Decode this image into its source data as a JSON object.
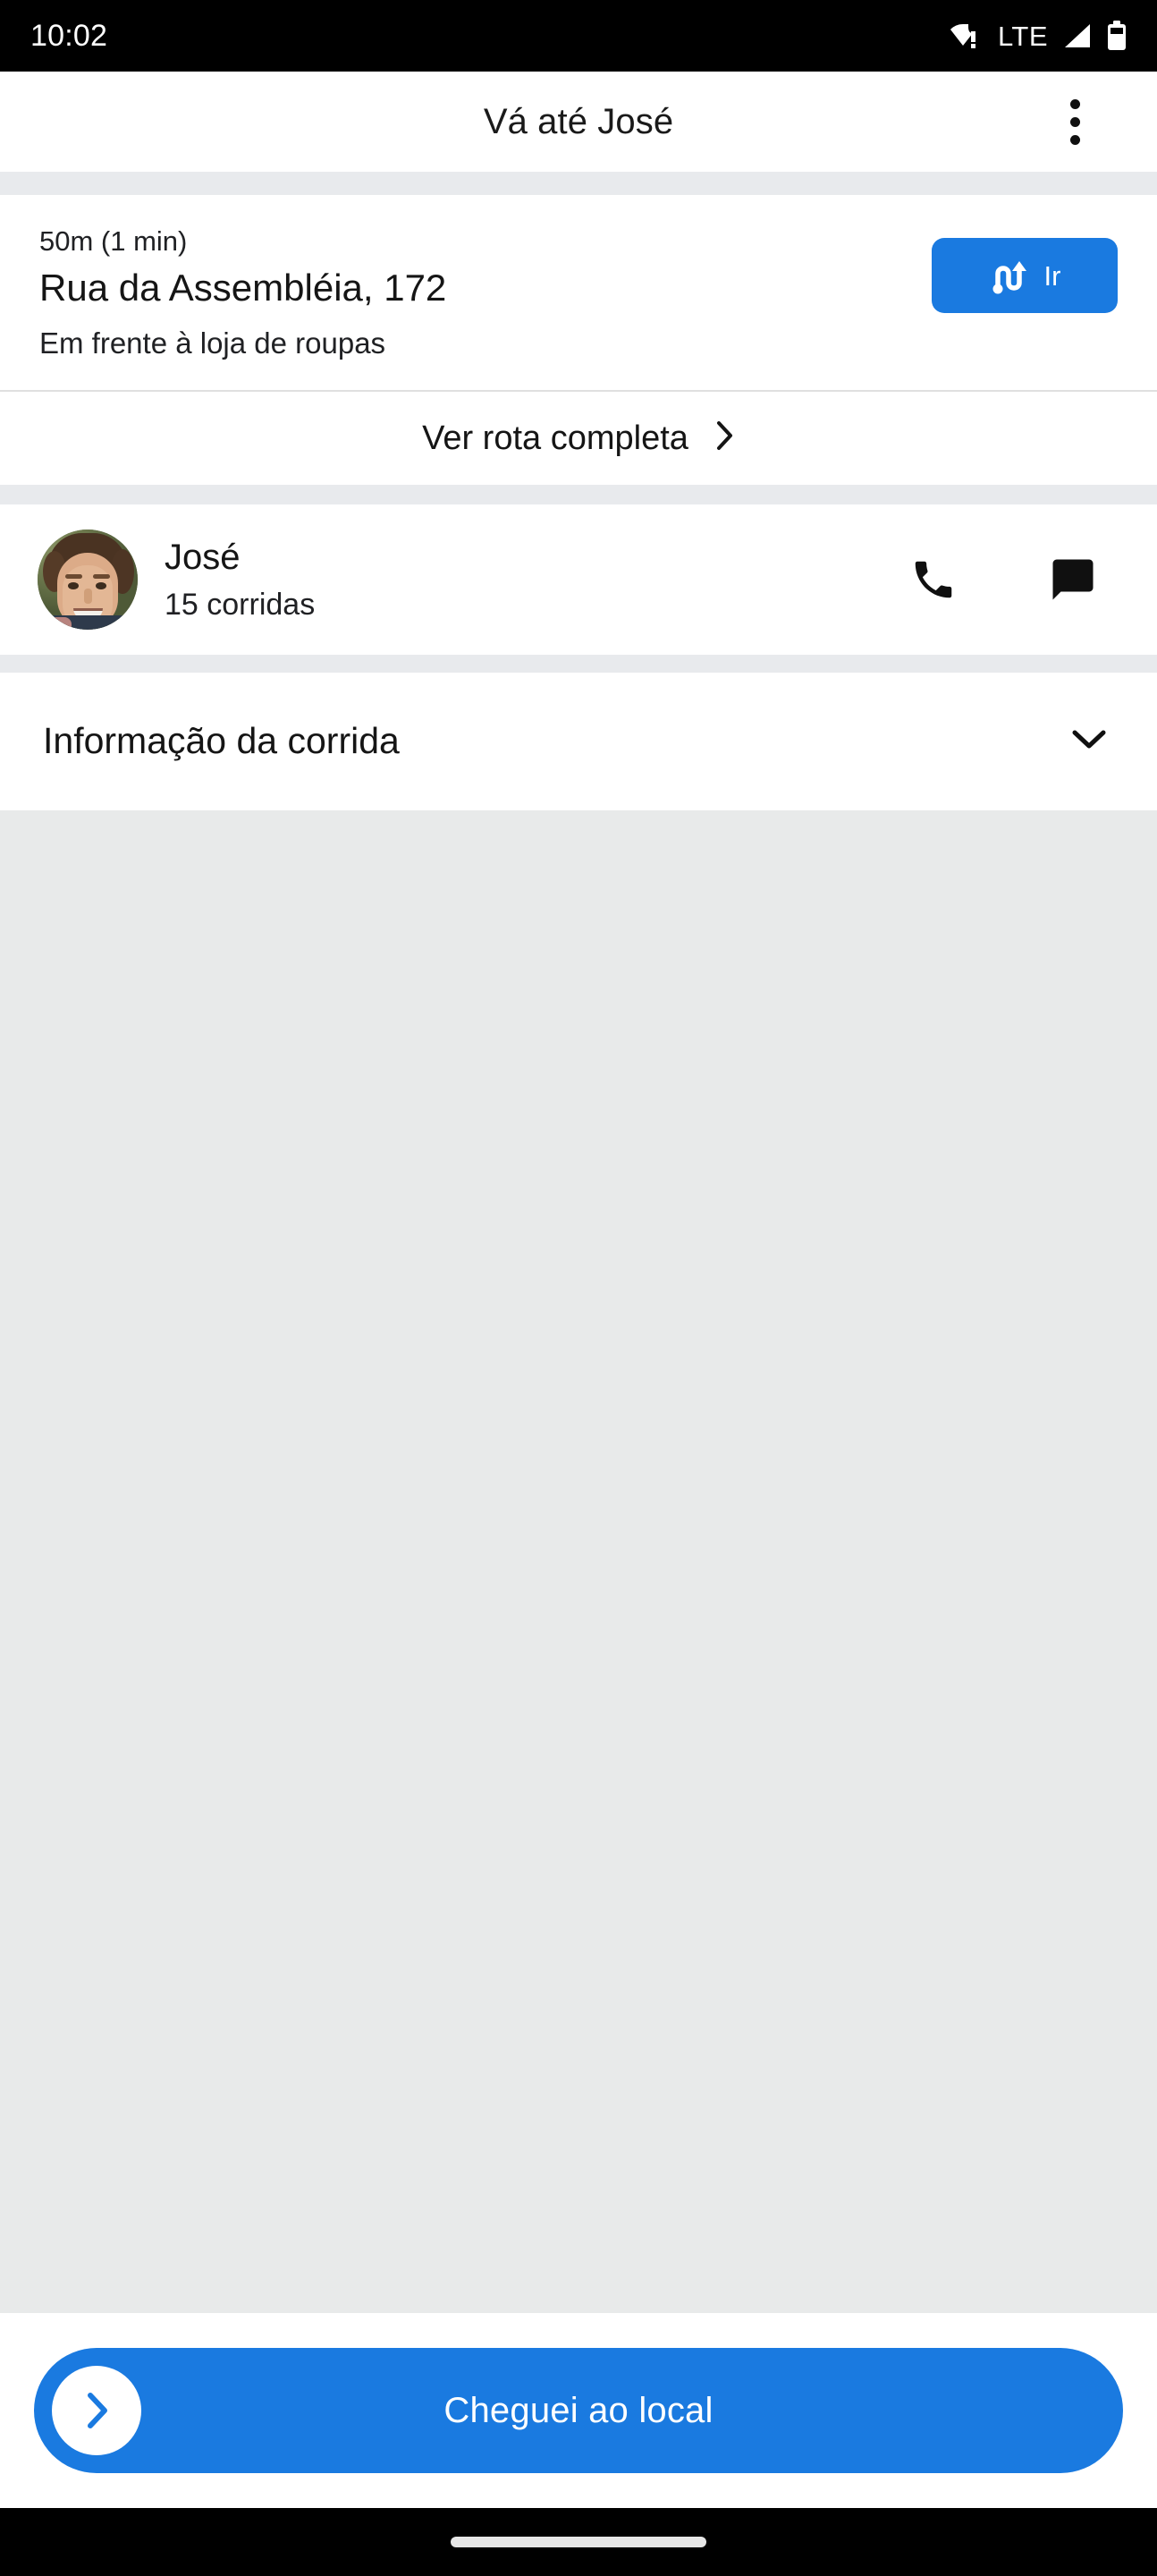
{
  "status_bar": {
    "time": "10:02",
    "network_label": "LTE",
    "wifi_icon": "wifi-warning-icon",
    "signal_icon": "signal-bars-icon",
    "battery_icon": "battery-icon"
  },
  "app_bar": {
    "title": "Vá até José",
    "overflow_icon": "more-vert-icon"
  },
  "destination": {
    "eta": "50m (1 min)",
    "address": "Rua da Assembléia, 172",
    "note": "Em frente à loja de roupas",
    "go_button_label": "Ir",
    "go_button_icon": "navigation-route-icon",
    "route_link_label": "Ver rota completa",
    "route_link_icon": "chevron-right-icon"
  },
  "driver": {
    "name": "José",
    "rides": "15 corridas",
    "avatar_icon": "avatar",
    "call_icon": "phone-icon",
    "message_icon": "chat-bubble-icon"
  },
  "ride_info": {
    "title": "Informação da corrida",
    "expand_icon": "chevron-down-icon"
  },
  "bottom_action": {
    "label": "Cheguei ao local",
    "thumb_icon": "chevron-right-icon"
  },
  "navigation_bar": {
    "home_indicator": "home-indicator"
  },
  "colors": {
    "accent_blue": "#1a7ae0",
    "separator_gray": "#e8eaed",
    "map_gray": "#e8eaea",
    "text_primary": "#151515",
    "status_bar_black": "#000000"
  }
}
